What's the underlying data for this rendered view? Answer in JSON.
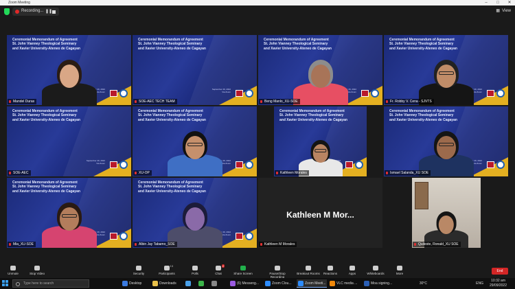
{
  "window": {
    "title": "Zoom Meeting"
  },
  "recording": {
    "label": "Recording..."
  },
  "view_label": "View",
  "slide_title_lines": [
    "Ceremonial Memorandum of Agreement",
    "St. John Vianney Theological Seminary",
    "and Xavier University-Ateneo de Cagayan"
  ],
  "tiles": [
    {
      "name": "Mandel Duras",
      "hasSlide": true,
      "person": {
        "skin": "#d9a786",
        "hair": "#2a1c14",
        "shirt": "#1b1b1b"
      }
    },
    {
      "name": "SOE-AEC TECH TEAM",
      "hasSlide": true,
      "person": null
    },
    {
      "name": "Beng Manlo_XU-SOE",
      "hasSlide": true,
      "person": {
        "skin": "#a87458",
        "hair": "#8c8c8c",
        "shirt": "#e74f63"
      }
    },
    {
      "name": "Fr. Robby V. Cena - SJVTS",
      "hasSlide": true,
      "person": {
        "skin": "#c08c68",
        "hair": "#222",
        "shirt": "#151515",
        "glasses": true
      }
    },
    {
      "name": "SOE-AEC",
      "hasSlide": true,
      "person": null
    },
    {
      "name": "XU-OP",
      "hasSlide": true,
      "person": {
        "skin": "#c6906c",
        "hair": "#111",
        "shirt": "#3f6fc4",
        "glasses": true
      }
    },
    {
      "name": "Kathleen Morales",
      "hasSlide": true,
      "person": {
        "skin": "#b98462",
        "hair": "#141414",
        "shirt": "#e8e8e8",
        "glasses": true
      }
    },
    {
      "name": "Ismael Salanda_XU SOE",
      "hasSlide": true,
      "active": true,
      "person": {
        "skin": "#9c6a4c",
        "hair": "#151515",
        "shirt": "#1e3260",
        "glasses": true
      }
    },
    {
      "name": "Mia_XU-SOE",
      "hasSlide": true,
      "person": {
        "skin": "#b37d5c",
        "hair": "#2a1a12",
        "shirt": "#d64470",
        "glasses": true
      }
    },
    {
      "name": "Albin Jay Tabamo_SOE",
      "hasSlide": true,
      "person": {
        "skin": "#8a6aa8",
        "hair": "#1c1c3a",
        "shirt": "#4d4d6a"
      }
    },
    {
      "name": "Kathleen M Morales",
      "hasSlide": false,
      "bigName": "Kathleen M  Mor...",
      "person": null
    },
    {
      "name": "Quileste, Ronald_XU SOE",
      "hasSlide": false,
      "room": true,
      "person": {
        "skin": "#b98866",
        "hair": "#151515",
        "shirt": "#2b2b2b"
      }
    }
  ],
  "slide_date": "September 29, 2022\nVia Zoom",
  "toolbar": {
    "items": [
      {
        "label": "Unmute",
        "icon": "microphone-muted-icon"
      },
      {
        "label": "Stop Video",
        "icon": "video-camera-icon"
      },
      {
        "label": "Security",
        "icon": "shield-icon"
      },
      {
        "label": "Participants",
        "icon": "participants-icon",
        "badge": "13"
      },
      {
        "label": "Polls",
        "icon": "polls-icon"
      },
      {
        "label": "Chat",
        "icon": "chat-icon",
        "badge": "2"
      },
      {
        "label": "Share Screen",
        "icon": "share-screen-icon",
        "green": true
      },
      {
        "label": "Pause/Stop Recording",
        "icon": "recording-icon"
      },
      {
        "label": "Breakout Rooms",
        "icon": "breakout-rooms-icon"
      },
      {
        "label": "Reactions",
        "icon": "reactions-icon"
      },
      {
        "label": "Apps",
        "icon": "apps-icon"
      },
      {
        "label": "Whiteboards",
        "icon": "whiteboard-icon"
      },
      {
        "label": "More",
        "icon": "more-icon"
      }
    ],
    "end_label": "End"
  },
  "taskbar": {
    "search_placeholder": "Type here to search",
    "apps": [
      {
        "label": "Desktop",
        "color": "#3b7be0"
      },
      {
        "label": "Downloads",
        "color": "#e8c04a"
      },
      {
        "label": "",
        "color": "#4aa0e8"
      },
      {
        "label": "",
        "color": "#3cb54a"
      },
      {
        "label": "",
        "color": "#888"
      },
      {
        "label": "(6) Messeng...",
        "color": "#9a5be0"
      },
      {
        "label": "Zoom Clou...",
        "color": "#2d8cff"
      },
      {
        "label": "Zoom Meeti...",
        "color": "#2d8cff",
        "active": true
      },
      {
        "label": "VLC media ...",
        "color": "#f0890c"
      },
      {
        "label": "Moa signing...",
        "color": "#2b5fb4"
      }
    ],
    "weather": "30°C",
    "lang": "ENG",
    "time": "10:32 am",
    "date": "29/09/2022"
  },
  "colors": {
    "accent": "#d6e84b",
    "end": "#d32626",
    "share": "#22b14c",
    "rec": "#e02828"
  }
}
